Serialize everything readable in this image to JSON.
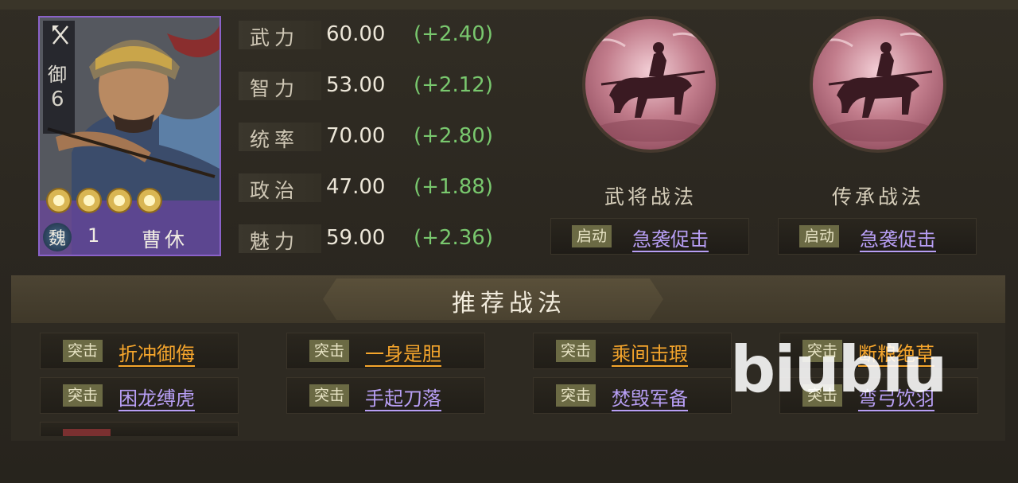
{
  "general": {
    "troop_rank_label": "御",
    "troop_rank_value": "6",
    "stars": 4,
    "faction": "魏",
    "level": "1",
    "name": "曹休",
    "troop_type_icon": "bow-icon"
  },
  "stats": [
    {
      "name": "武力",
      "value": "60.00",
      "bonus": "(+2.40)"
    },
    {
      "name": "智力",
      "value": "53.00",
      "bonus": "(+2.12)"
    },
    {
      "name": "统率",
      "value": "70.00",
      "bonus": "(+2.80)"
    },
    {
      "name": "政治",
      "value": "47.00",
      "bonus": "(+1.88)"
    },
    {
      "name": "魅力",
      "value": "59.00",
      "bonus": "(+2.36)"
    }
  ],
  "tactics": [
    {
      "title": "武将战法",
      "type": "启动",
      "name": "急袭促击"
    },
    {
      "title": "传承战法",
      "type": "启动",
      "name": "急袭促击"
    }
  ],
  "recommended": {
    "title": "推荐战法",
    "items": [
      {
        "type": "突击",
        "name": "折冲御侮",
        "color": "orange"
      },
      {
        "type": "突击",
        "name": "一身是胆",
        "color": "orange"
      },
      {
        "type": "突击",
        "name": "乘间击瑕",
        "color": "orange"
      },
      {
        "type": "突击",
        "name": "断粮绝草",
        "color": "orange"
      },
      {
        "type": "突击",
        "name": "困龙缚虎",
        "color": "purple"
      },
      {
        "type": "突击",
        "name": "手起刀落",
        "color": "purple"
      },
      {
        "type": "突击",
        "name": "焚毁军备",
        "color": "purple"
      },
      {
        "type": "突击",
        "name": "弯弓饮羽",
        "color": "purple"
      }
    ]
  },
  "watermark": "biubiu",
  "colors": {
    "bonus": "#79c86e",
    "orange": "#f5a52c",
    "purple": "#b79ef4",
    "card_border": "#8a62c9"
  }
}
